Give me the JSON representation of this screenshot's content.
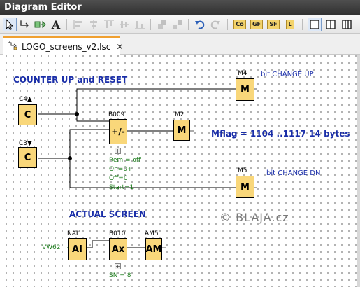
{
  "window": {
    "title": "Diagram Editor"
  },
  "toolbar": {
    "buttons": [
      {
        "name": "select-tool-icon"
      },
      {
        "name": "connect-tool-icon"
      },
      {
        "name": "block-tool-icon"
      },
      {
        "name": "text-tool-icon",
        "glyph": "A"
      },
      {
        "name": "align-left-icon"
      },
      {
        "name": "align-center-icon"
      },
      {
        "name": "align-top-icon"
      },
      {
        "name": "align-middle-icon"
      },
      {
        "name": "align-bottom-icon"
      },
      {
        "name": "group-icon"
      },
      {
        "name": "ungroup-icon"
      },
      {
        "name": "undo-icon"
      },
      {
        "name": "redo-icon"
      },
      {
        "name": "co-button",
        "label": "Co"
      },
      {
        "name": "gf-button",
        "label": "GF"
      },
      {
        "name": "sf-button",
        "label": "SF"
      },
      {
        "name": "l-button",
        "label": "L"
      },
      {
        "name": "view-single-icon"
      },
      {
        "name": "view-split-icon"
      },
      {
        "name": "view-triple-icon"
      }
    ]
  },
  "tab": {
    "label": "LOGO_screens_v2.lsc",
    "close": "✕"
  },
  "diagram": {
    "heading_counter": "COUNTER UP and RESET",
    "heading_screen": "ACTUAL SCREEN",
    "mflag_note": "Mflag = 1104 ..1117 14 bytes",
    "watermark": "© BLAJA.cz",
    "comment_up": "bit CHANGE UP",
    "comment_dn": "bit CHANGE DN",
    "blocks": {
      "c4": {
        "name": "C4",
        "symbol": "C",
        "arrow": "▲"
      },
      "c3": {
        "name": "C3",
        "symbol": "C",
        "arrow": "▼"
      },
      "b009": {
        "name": "B009",
        "symbol": "+/-"
      },
      "m2": {
        "name": "M2",
        "symbol": "M"
      },
      "m4": {
        "name": "M4",
        "symbol": "M"
      },
      "m5": {
        "name": "M5",
        "symbol": "M"
      },
      "nai1": {
        "name": "NAI1",
        "symbol": "AI"
      },
      "b010": {
        "name": "B010",
        "symbol": "Ax"
      },
      "am5": {
        "name": "AM5",
        "symbol": "AM"
      }
    },
    "b009_params": [
      "Rem = off",
      "On=0+",
      "Off=0",
      "Start=1"
    ],
    "b010_params": [
      "SN = 8"
    ],
    "vw_label": "VW62"
  }
}
